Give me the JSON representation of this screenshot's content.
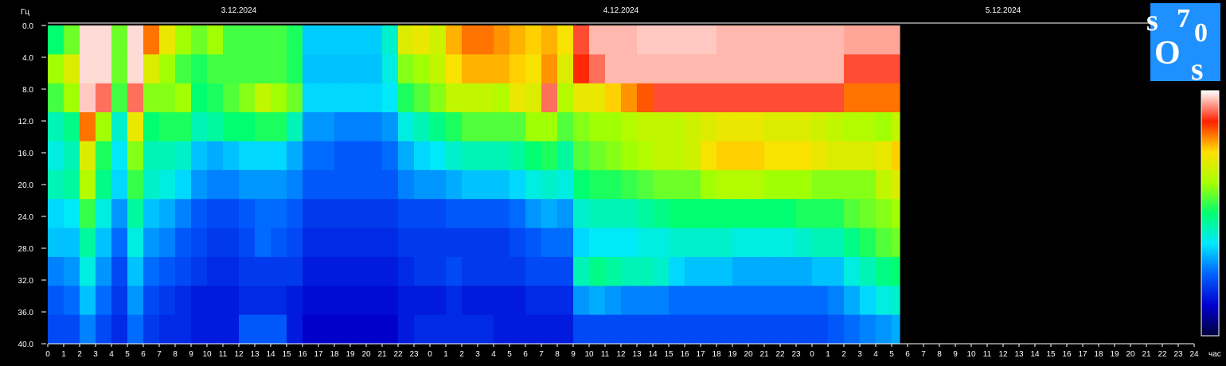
{
  "chart_data": {
    "type": "heatmap",
    "title": "",
    "ylabel": "Гц",
    "xlabel": "час",
    "dates": [
      "3.12.2024",
      "4.12.2024",
      "5.12.2024"
    ],
    "ylim": [
      0,
      40
    ],
    "y_ticks": [
      "0.0",
      "4.0",
      "8.0",
      "12.0",
      "16.0",
      "20.0",
      "24.0",
      "28.0",
      "32.0",
      "36.0",
      "40.0"
    ],
    "x_hours_per_day": [
      [
        "0",
        "1",
        "2",
        "3",
        "4",
        "5",
        "6",
        "7",
        "8",
        "9",
        "10",
        "11",
        "12",
        "13",
        "14",
        "15",
        "16",
        "17",
        "18",
        "19",
        "20",
        "21",
        "22",
        "23"
      ],
      [
        "0",
        "1",
        "2",
        "3",
        "4",
        "5",
        "6",
        "7",
        "8",
        "9",
        "10",
        "11",
        "12",
        "13",
        "14",
        "15",
        "16",
        "17",
        "18",
        "19",
        "20",
        "21",
        "22",
        "23"
      ],
      [
        "0",
        "1",
        "2",
        "3",
        "4",
        "5",
        "6",
        "7",
        "8",
        "9",
        "10",
        "11",
        "12",
        "13",
        "14",
        "15",
        "16",
        "17",
        "18",
        "19",
        "20",
        "21",
        "22",
        "23",
        "24"
      ]
    ],
    "data_end_hours": 53.5,
    "colorbar": {
      "colors": [
        "#00003c",
        "#0000d0",
        "#0060ff",
        "#00e8ff",
        "#00ff70",
        "#a8ff00",
        "#ffe000",
        "#ff2000",
        "#ffffff"
      ]
    },
    "intensity_rows": [
      [
        0.5,
        0.58,
        0.98,
        0.98,
        0.58,
        0.98,
        0.82,
        0.72,
        0.62,
        0.58,
        0.62,
        0.55,
        0.55,
        0.55,
        0.55,
        0.52,
        0.35,
        0.35,
        0.35,
        0.35,
        0.35,
        0.42,
        0.7,
        0.72,
        0.68,
        0.78,
        0.82,
        0.82,
        0.8,
        0.78,
        0.76,
        0.78,
        0.74,
        0.9,
        0.96,
        0.96,
        0.96,
        0.97,
        0.97,
        0.97,
        0.97,
        0.97,
        0.96,
        0.96,
        0.96,
        0.96,
        0.96,
        0.96,
        0.96,
        0.96,
        0.95,
        0.95,
        0.95,
        0.95
      ],
      [
        0.62,
        0.7,
        0.98,
        0.98,
        0.58,
        0.98,
        0.7,
        0.62,
        0.55,
        0.52,
        0.55,
        0.55,
        0.55,
        0.55,
        0.55,
        0.52,
        0.34,
        0.34,
        0.34,
        0.34,
        0.34,
        0.4,
        0.6,
        0.62,
        0.66,
        0.74,
        0.78,
        0.78,
        0.78,
        0.76,
        0.74,
        0.8,
        0.7,
        0.88,
        0.92,
        0.96,
        0.96,
        0.96,
        0.96,
        0.96,
        0.96,
        0.96,
        0.96,
        0.96,
        0.96,
        0.96,
        0.96,
        0.96,
        0.96,
        0.96,
        0.9,
        0.9,
        0.9,
        0.9
      ],
      [
        0.55,
        0.62,
        0.97,
        0.92,
        0.55,
        0.92,
        0.6,
        0.6,
        0.62,
        0.5,
        0.52,
        0.56,
        0.6,
        0.66,
        0.62,
        0.58,
        0.36,
        0.36,
        0.36,
        0.36,
        0.36,
        0.38,
        0.52,
        0.56,
        0.6,
        0.66,
        0.66,
        0.66,
        0.64,
        0.72,
        0.7,
        0.92,
        0.64,
        0.72,
        0.72,
        0.76,
        0.8,
        0.84,
        0.9,
        0.9,
        0.9,
        0.9,
        0.9,
        0.9,
        0.9,
        0.9,
        0.9,
        0.9,
        0.9,
        0.9,
        0.82,
        0.82,
        0.82,
        0.82
      ],
      [
        0.44,
        0.48,
        0.82,
        0.62,
        0.42,
        0.72,
        0.5,
        0.52,
        0.52,
        0.44,
        0.46,
        0.5,
        0.5,
        0.52,
        0.52,
        0.44,
        0.3,
        0.3,
        0.28,
        0.28,
        0.28,
        0.3,
        0.4,
        0.44,
        0.48,
        0.52,
        0.56,
        0.56,
        0.56,
        0.56,
        0.62,
        0.62,
        0.56,
        0.6,
        0.62,
        0.62,
        0.64,
        0.66,
        0.66,
        0.66,
        0.68,
        0.7,
        0.72,
        0.72,
        0.72,
        0.7,
        0.7,
        0.7,
        0.68,
        0.66,
        0.64,
        0.64,
        0.62,
        0.66
      ],
      [
        0.4,
        0.44,
        0.7,
        0.52,
        0.38,
        0.6,
        0.44,
        0.44,
        0.42,
        0.34,
        0.32,
        0.34,
        0.36,
        0.36,
        0.36,
        0.32,
        0.26,
        0.26,
        0.24,
        0.24,
        0.24,
        0.26,
        0.32,
        0.36,
        0.38,
        0.42,
        0.44,
        0.44,
        0.44,
        0.46,
        0.5,
        0.52,
        0.46,
        0.56,
        0.58,
        0.6,
        0.62,
        0.64,
        0.66,
        0.66,
        0.68,
        0.74,
        0.76,
        0.76,
        0.76,
        0.74,
        0.74,
        0.74,
        0.72,
        0.7,
        0.7,
        0.7,
        0.72,
        0.76
      ],
      [
        0.44,
        0.46,
        0.64,
        0.48,
        0.36,
        0.54,
        0.42,
        0.4,
        0.36,
        0.3,
        0.28,
        0.28,
        0.3,
        0.3,
        0.3,
        0.28,
        0.24,
        0.24,
        0.24,
        0.24,
        0.24,
        0.24,
        0.28,
        0.3,
        0.3,
        0.32,
        0.34,
        0.34,
        0.34,
        0.36,
        0.4,
        0.42,
        0.4,
        0.5,
        0.52,
        0.52,
        0.54,
        0.56,
        0.58,
        0.58,
        0.58,
        0.62,
        0.64,
        0.64,
        0.64,
        0.62,
        0.62,
        0.62,
        0.6,
        0.6,
        0.6,
        0.6,
        0.66,
        0.7
      ],
      [
        0.36,
        0.38,
        0.54,
        0.4,
        0.3,
        0.46,
        0.34,
        0.32,
        0.28,
        0.24,
        0.22,
        0.22,
        0.24,
        0.26,
        0.26,
        0.24,
        0.2,
        0.2,
        0.2,
        0.2,
        0.2,
        0.2,
        0.22,
        0.22,
        0.22,
        0.24,
        0.24,
        0.24,
        0.24,
        0.26,
        0.3,
        0.32,
        0.3,
        0.42,
        0.44,
        0.44,
        0.44,
        0.46,
        0.48,
        0.5,
        0.5,
        0.5,
        0.5,
        0.5,
        0.5,
        0.5,
        0.5,
        0.52,
        0.52,
        0.52,
        0.56,
        0.58,
        0.6,
        0.62
      ],
      [
        0.34,
        0.34,
        0.46,
        0.34,
        0.26,
        0.4,
        0.3,
        0.28,
        0.24,
        0.22,
        0.2,
        0.2,
        0.22,
        0.26,
        0.24,
        0.22,
        0.18,
        0.18,
        0.18,
        0.18,
        0.18,
        0.18,
        0.2,
        0.2,
        0.2,
        0.2,
        0.2,
        0.2,
        0.2,
        0.22,
        0.24,
        0.26,
        0.26,
        0.36,
        0.38,
        0.38,
        0.38,
        0.4,
        0.4,
        0.42,
        0.42,
        0.42,
        0.42,
        0.4,
        0.4,
        0.4,
        0.4,
        0.42,
        0.44,
        0.44,
        0.48,
        0.52,
        0.56,
        0.58
      ],
      [
        0.28,
        0.3,
        0.4,
        0.3,
        0.22,
        0.34,
        0.26,
        0.24,
        0.22,
        0.2,
        0.18,
        0.18,
        0.2,
        0.2,
        0.2,
        0.2,
        0.16,
        0.16,
        0.16,
        0.16,
        0.16,
        0.16,
        0.18,
        0.2,
        0.2,
        0.22,
        0.2,
        0.2,
        0.2,
        0.2,
        0.22,
        0.22,
        0.22,
        0.44,
        0.48,
        0.46,
        0.44,
        0.44,
        0.42,
        0.36,
        0.34,
        0.34,
        0.34,
        0.32,
        0.32,
        0.32,
        0.32,
        0.32,
        0.34,
        0.34,
        0.4,
        0.44,
        0.48,
        0.5
      ],
      [
        0.24,
        0.26,
        0.34,
        0.26,
        0.2,
        0.3,
        0.22,
        0.2,
        0.18,
        0.16,
        0.16,
        0.16,
        0.18,
        0.18,
        0.18,
        0.16,
        0.14,
        0.14,
        0.14,
        0.14,
        0.14,
        0.14,
        0.16,
        0.16,
        0.16,
        0.18,
        0.16,
        0.16,
        0.16,
        0.16,
        0.18,
        0.18,
        0.18,
        0.3,
        0.32,
        0.3,
        0.28,
        0.28,
        0.28,
        0.26,
        0.26,
        0.26,
        0.26,
        0.26,
        0.26,
        0.26,
        0.26,
        0.26,
        0.26,
        0.28,
        0.32,
        0.36,
        0.4,
        0.42
      ],
      [
        0.22,
        0.22,
        0.28,
        0.22,
        0.18,
        0.26,
        0.2,
        0.18,
        0.18,
        0.16,
        0.16,
        0.16,
        0.24,
        0.24,
        0.24,
        0.16,
        0.12,
        0.12,
        0.12,
        0.12,
        0.12,
        0.12,
        0.16,
        0.18,
        0.18,
        0.18,
        0.18,
        0.18,
        0.16,
        0.16,
        0.16,
        0.16,
        0.16,
        0.22,
        0.22,
        0.22,
        0.22,
        0.22,
        0.22,
        0.22,
        0.22,
        0.22,
        0.22,
        0.22,
        0.22,
        0.22,
        0.22,
        0.22,
        0.22,
        0.24,
        0.26,
        0.28,
        0.3,
        0.32
      ]
    ]
  }
}
